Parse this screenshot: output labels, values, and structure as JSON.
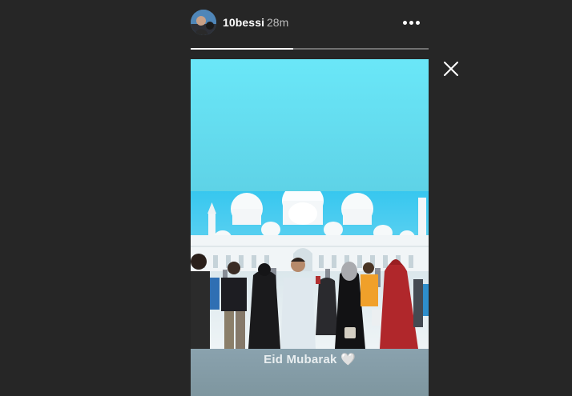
{
  "header": {
    "username": "10bessi",
    "time": "28m",
    "more_icon": "more-horizontal-icon"
  },
  "progress": {
    "fraction": 0.43
  },
  "close_icon": "close-icon",
  "story": {
    "caption": "Eid Mubarak",
    "caption_emoji": "🤍"
  },
  "colors": {
    "background": "#262626",
    "sky_top": "#6ae7f8",
    "sky_bottom": "#55c4da",
    "text": "#ffffff"
  }
}
